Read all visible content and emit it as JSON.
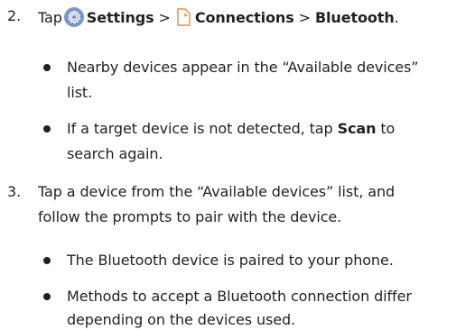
{
  "colors": {
    "text": "#231f20",
    "settings_icon": "#7a96c8",
    "connections_icon": "#e38d3e"
  },
  "step2": {
    "number": "2.",
    "tap": "Tap",
    "settings": "Settings",
    "sep1": ">",
    "connections": "Connections",
    "sep2": ">",
    "bluetooth": "Bluetooth",
    "end": ".",
    "icons": [
      "gear-icon",
      "connections-icon"
    ],
    "bullets": [
      {
        "line1": "Nearby devices appear in the “Available devices”",
        "line2": "list."
      },
      {
        "line1_pre": "If a target device is not detected, tap",
        "line1_bold": "Scan",
        "line1_post": "to",
        "line2": "search again."
      }
    ]
  },
  "step3": {
    "number": "3.",
    "line1": "Tap a device from the “Available devices” list, and",
    "line2": "follow the prompts to pair with the device.",
    "bullets": [
      {
        "line1": "The Bluetooth device is paired to your phone."
      },
      {
        "line1": "Methods to accept a Bluetooth connection differ",
        "line2": "depending on the devices used."
      }
    ]
  }
}
